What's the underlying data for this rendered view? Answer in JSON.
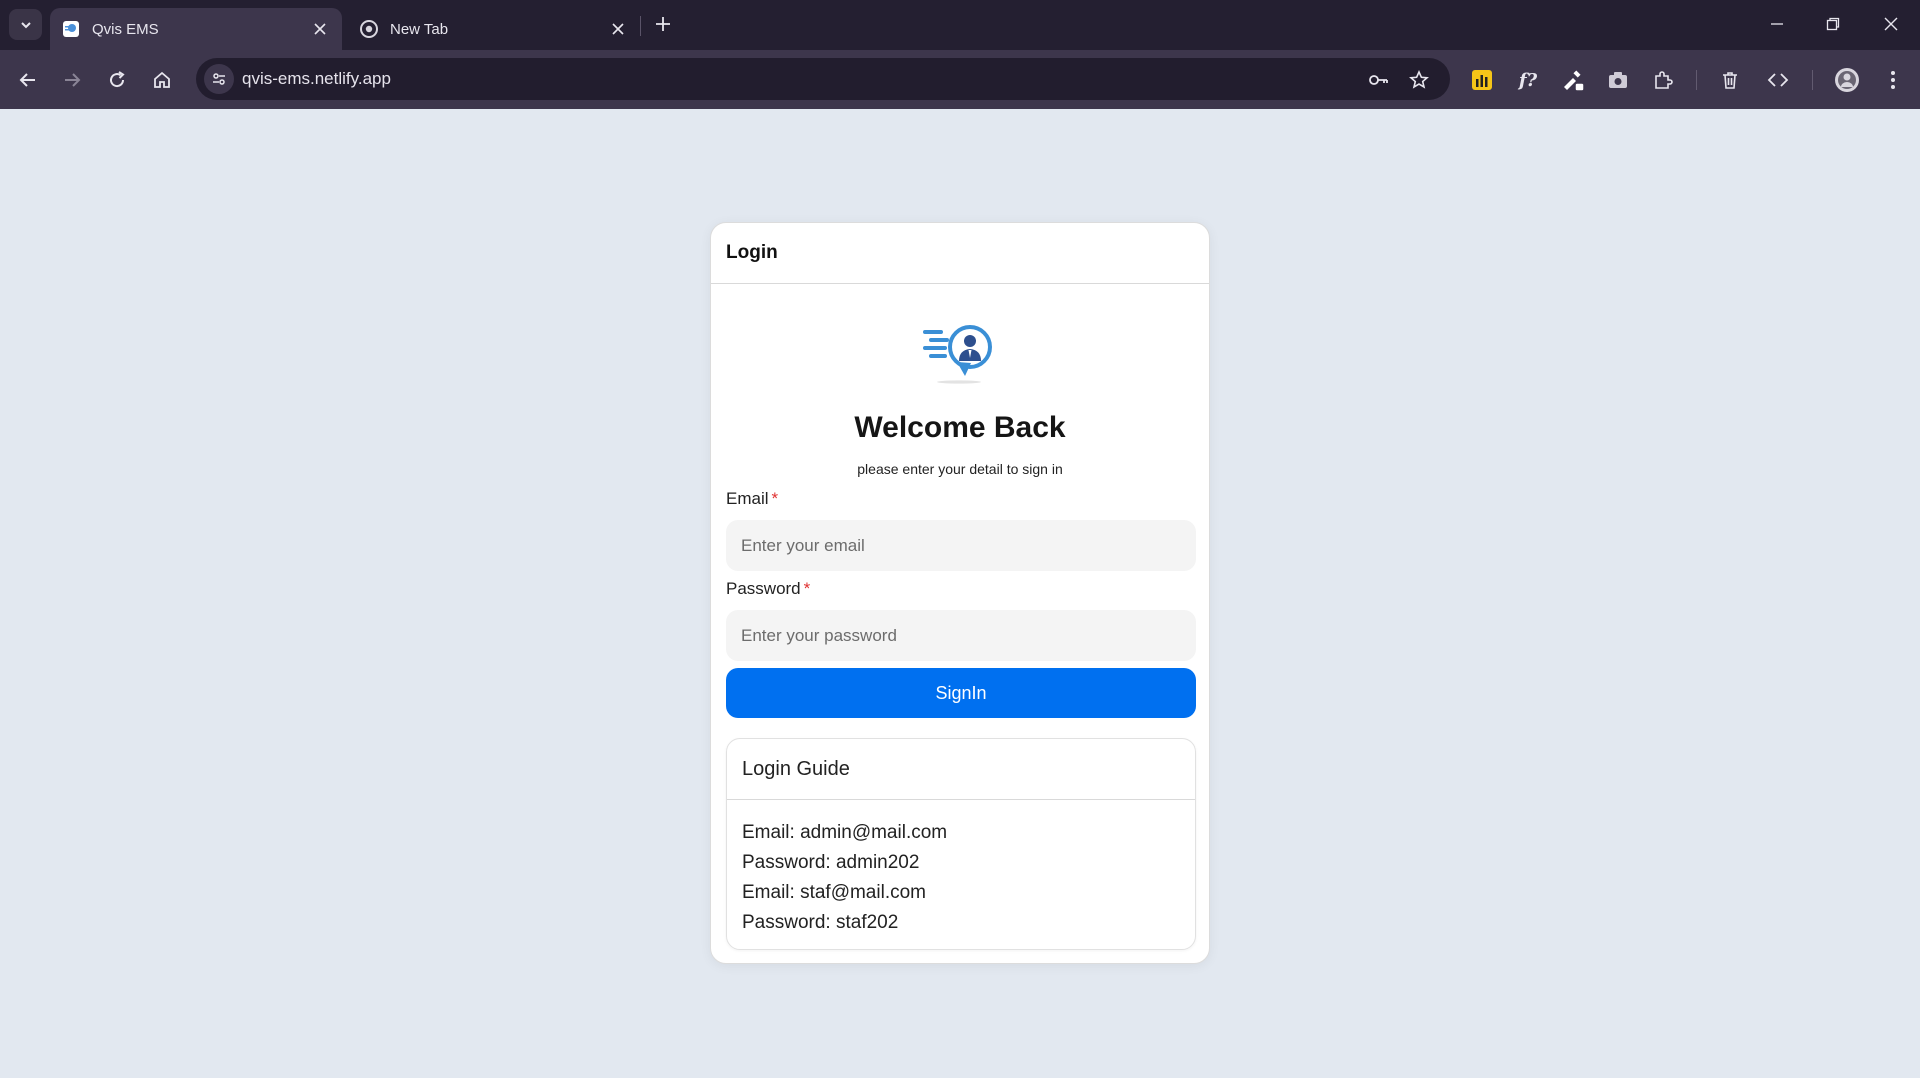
{
  "browser": {
    "tabs": [
      {
        "title": "Qvis EMS",
        "active": true
      },
      {
        "title": "New Tab",
        "active": false
      }
    ],
    "url": "qvis-ems.netlify.app"
  },
  "login": {
    "header": "Login",
    "welcome_title": "Welcome Back",
    "subtitle": "please enter your detail to sign in",
    "email_label": "Email",
    "email_placeholder": "Enter your email",
    "password_label": "Password",
    "password_placeholder": "Enter your password",
    "required_marker": "*",
    "signin_label": "SignIn"
  },
  "guide": {
    "title": "Login Guide",
    "lines": [
      "Email: admin@mail.com",
      "Password: admin202",
      "Email: staf@mail.com",
      "Password: staf202"
    ]
  },
  "colors": {
    "page_bg": "#e2e8f0",
    "primary_button": "#0070f0",
    "required": "#e03131",
    "chrome_dark": "#241f31",
    "chrome_toolbar": "#3d364c"
  }
}
